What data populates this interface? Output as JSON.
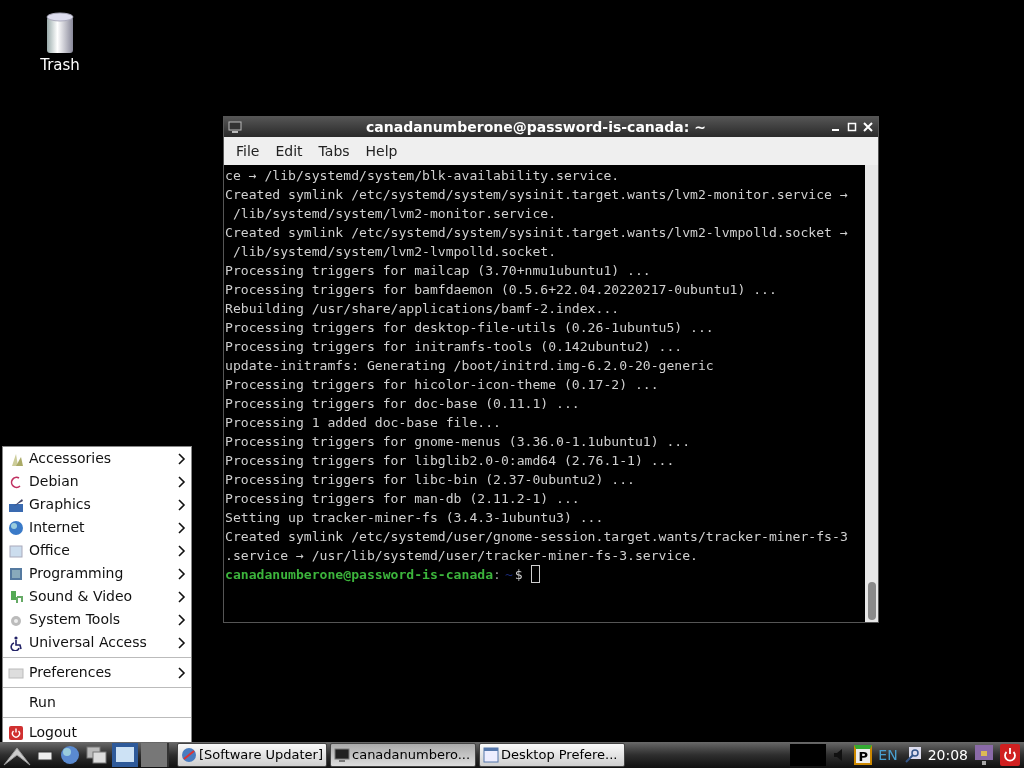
{
  "desktop_icons": [
    {
      "label": "Trash"
    }
  ],
  "terminal": {
    "title": "canadanumberone@password-is-canada: ~",
    "menu": [
      "File",
      "Edit",
      "Tabs",
      "Help"
    ],
    "lines": [
      {
        "kind": "output",
        "text": "ce → /lib/systemd/system/blk-availability.service."
      },
      {
        "kind": "output",
        "text": "Created symlink /etc/systemd/system/sysinit.target.wants/lvm2-monitor.service →"
      },
      {
        "kind": "output",
        "text": " /lib/systemd/system/lvm2-monitor.service."
      },
      {
        "kind": "output",
        "text": "Created symlink /etc/systemd/system/sysinit.target.wants/lvm2-lvmpolld.socket →"
      },
      {
        "kind": "output",
        "text": " /lib/systemd/system/lvm2-lvmpolld.socket."
      },
      {
        "kind": "output",
        "text": "Processing triggers for mailcap (3.70+nmu1ubuntu1) ..."
      },
      {
        "kind": "output",
        "text": "Processing triggers for bamfdaemon (0.5.6+22.04.20220217-0ubuntu1) ..."
      },
      {
        "kind": "output",
        "text": "Rebuilding /usr/share/applications/bamf-2.index..."
      },
      {
        "kind": "output",
        "text": "Processing triggers for desktop-file-utils (0.26-1ubuntu5) ..."
      },
      {
        "kind": "output",
        "text": "Processing triggers for initramfs-tools (0.142ubuntu2) ..."
      },
      {
        "kind": "output",
        "text": "update-initramfs: Generating /boot/initrd.img-6.2.0-20-generic"
      },
      {
        "kind": "output",
        "text": "Processing triggers for hicolor-icon-theme (0.17-2) ..."
      },
      {
        "kind": "output",
        "text": "Processing triggers for doc-base (0.11.1) ..."
      },
      {
        "kind": "output",
        "text": "Processing 1 added doc-base file..."
      },
      {
        "kind": "output",
        "text": "Processing triggers for gnome-menus (3.36.0-1.1ubuntu1) ..."
      },
      {
        "kind": "output",
        "text": "Processing triggers for libglib2.0-0:amd64 (2.76.1-1) ..."
      },
      {
        "kind": "output",
        "text": "Processing triggers for libc-bin (2.37-0ubuntu2) ..."
      },
      {
        "kind": "output",
        "text": "Processing triggers for man-db (2.11.2-1) ..."
      },
      {
        "kind": "output",
        "text": "Setting up tracker-miner-fs (3.4.3-1ubuntu3) ..."
      },
      {
        "kind": "output",
        "text": "Created symlink /etc/systemd/user/gnome-session.target.wants/tracker-miner-fs-3"
      },
      {
        "kind": "output",
        "text": ".service → /usr/lib/systemd/user/tracker-miner-fs-3.service."
      },
      {
        "kind": "prompt",
        "user_host": "canadanumberone@password-is-canada",
        "separator": ":",
        "path": "~",
        "symbol": "$"
      }
    ]
  },
  "start_menu": {
    "sections": [
      [
        {
          "label": "Accessories",
          "submenu": true
        },
        {
          "label": "Debian",
          "submenu": true
        },
        {
          "label": "Graphics",
          "submenu": true
        },
        {
          "label": "Internet",
          "submenu": true
        },
        {
          "label": "Office",
          "submenu": true
        },
        {
          "label": "Programming",
          "submenu": true
        },
        {
          "label": "Sound & Video",
          "submenu": true
        },
        {
          "label": "System Tools",
          "submenu": true
        },
        {
          "label": "Universal Access",
          "submenu": true
        }
      ],
      [
        {
          "label": "Preferences",
          "submenu": true
        }
      ],
      [
        {
          "label": "Run",
          "submenu": false
        }
      ],
      [
        {
          "label": "Logout",
          "submenu": false
        }
      ]
    ]
  },
  "taskbar": {
    "tasks": [
      {
        "label": "[Software Updater]",
        "selected": false
      },
      {
        "label": "canadanumbero...",
        "selected": true
      },
      {
        "label": "Desktop Prefere...",
        "selected": false
      }
    ],
    "tray_badge": "P",
    "keyboard_layout": "EN",
    "clock": "20:08"
  }
}
